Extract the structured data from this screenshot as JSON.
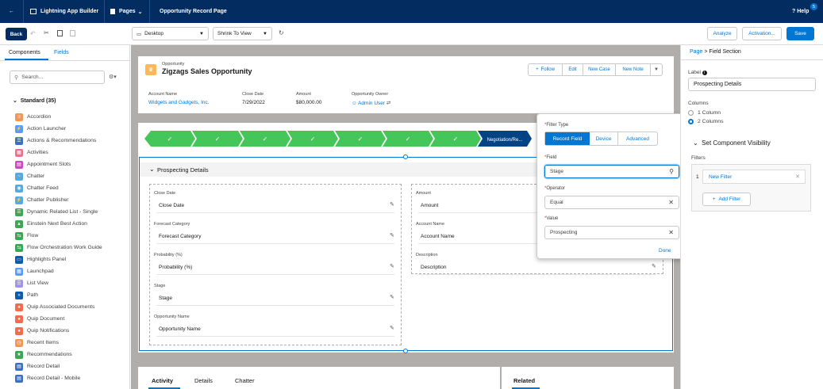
{
  "topbar": {
    "back_icon": "arrow-left-icon",
    "app_name": "Lightning App Builder",
    "pages_label": "Pages",
    "page_title": "Opportunity Record Page",
    "help_label": "? Help",
    "help_badge": "5"
  },
  "toolbar": {
    "back_label": "Back",
    "device_value": "Desktop",
    "view_value": "Shrink To View",
    "analyze_label": "Analyze",
    "activation_label": "Activation...",
    "save_label": "Save"
  },
  "left": {
    "tabs": [
      "Components",
      "Fields"
    ],
    "search_placeholder": "Search...",
    "section_label": "Standard (35)",
    "components": [
      {
        "label": "Accordion",
        "color": "#f49756",
        "glyph": "≡"
      },
      {
        "label": "Action Launcher",
        "color": "#5a9bff",
        "glyph": "⚡"
      },
      {
        "label": "Actions & Recommendations",
        "color": "#3c6fbe",
        "glyph": "☰"
      },
      {
        "label": "Activities",
        "color": "#eb7092",
        "glyph": "▦"
      },
      {
        "label": "Appointment Slots",
        "color": "#cb4bc3",
        "glyph": "▤"
      },
      {
        "label": "Chatter",
        "color": "#56aadf",
        "glyph": "~"
      },
      {
        "label": "Chatter Feed",
        "color": "#56aadf",
        "glyph": "◉"
      },
      {
        "label": "Chatter Publisher",
        "color": "#56aadf",
        "glyph": "⚡"
      },
      {
        "label": "Dynamic Related List - Single",
        "color": "#3ba755",
        "glyph": "☰"
      },
      {
        "label": "Einstein Next Best Action",
        "color": "#3ba755",
        "glyph": "▲"
      },
      {
        "label": "Flow",
        "color": "#3ba755",
        "glyph": "⇆"
      },
      {
        "label": "Flow Orchestration Work Guide",
        "color": "#3ba755",
        "glyph": "⇆"
      },
      {
        "label": "Highlights Panel",
        "color": "#0b5cab",
        "glyph": "▭"
      },
      {
        "label": "Launchpad",
        "color": "#5a9bff",
        "glyph": "▦"
      },
      {
        "label": "List View",
        "color": "#a094ed",
        "glyph": "☰"
      },
      {
        "label": "Path",
        "color": "#0b5cab",
        "glyph": "»"
      },
      {
        "label": "Quip Associated Documents",
        "color": "#f26c4f",
        "glyph": "●"
      },
      {
        "label": "Quip Document",
        "color": "#f26c4f",
        "glyph": "●"
      },
      {
        "label": "Quip Notifications",
        "color": "#f26c4f",
        "glyph": "●"
      },
      {
        "label": "Recent Items",
        "color": "#f49756",
        "glyph": "◷"
      },
      {
        "label": "Recommendations",
        "color": "#3ba755",
        "glyph": "★"
      },
      {
        "label": "Record Detail",
        "color": "#3c6fbe",
        "glyph": "▤"
      },
      {
        "label": "Record Detail - Mobile",
        "color": "#3c6fbe",
        "glyph": "▤"
      }
    ]
  },
  "highlights": {
    "object_label": "Opportunity",
    "record_name": "Zigzags Sales Opportunity",
    "actions": [
      "Follow",
      "Edit",
      "New Case",
      "New Note"
    ],
    "fields": [
      {
        "label": "Account Name",
        "value": "Widgets and Gadgets, Inc."
      },
      {
        "label": "Close Date",
        "value": "7/29/2022"
      },
      {
        "label": "Amount",
        "value": "$80,000.00"
      },
      {
        "label": "Opportunity Owner",
        "value": "Admin User"
      }
    ]
  },
  "path": {
    "current_stage": "Negotiation/Re..."
  },
  "section": {
    "title": "Prospecting Details",
    "left_fields": [
      {
        "label": "Close Date",
        "value": "Close Date"
      },
      {
        "label": "Forecast Category",
        "value": "Forecast Category"
      },
      {
        "label": "Probability (%)",
        "value": "Probability (%)"
      },
      {
        "label": "Stage",
        "value": "Stage"
      },
      {
        "label": "Opportunity Name",
        "value": "Opportunity Name"
      }
    ],
    "right_fields": [
      {
        "label": "Amount",
        "value": "Amount"
      },
      {
        "label": "Account Name",
        "value": "Account Name"
      },
      {
        "label": "Description",
        "value": "Description"
      }
    ]
  },
  "bottom": {
    "tabs": [
      "Activity",
      "Details",
      "Chatter"
    ],
    "related_label": "Related"
  },
  "popover": {
    "filter_type_label": "Filter Type",
    "filter_types": [
      "Record Field",
      "Device",
      "Advanced"
    ],
    "field_label": "Field",
    "field_value": "Stage",
    "operator_label": "Operator",
    "operator_value": "Equal",
    "value_label": "Value",
    "value_value": "Prospecting",
    "done_label": "Done"
  },
  "right": {
    "breadcrumb_page": "Page",
    "breadcrumb_sep": ">",
    "breadcrumb_current": "Field Section",
    "label_label": "Label",
    "label_value": "Prospecting Details",
    "columns_label": "Columns",
    "col_options": [
      "1 Column",
      "2 Columns"
    ],
    "visibility_title": "Set Component Visibility",
    "filters_label": "Filters",
    "filter_number": "1",
    "filter_name": "New Filter",
    "add_filter_label": "Add Filter"
  },
  "colors": {
    "brand_navy": "#032d60",
    "brand_blue": "#0176d3",
    "path_green": "#45c65a",
    "path_current": "#014486"
  }
}
